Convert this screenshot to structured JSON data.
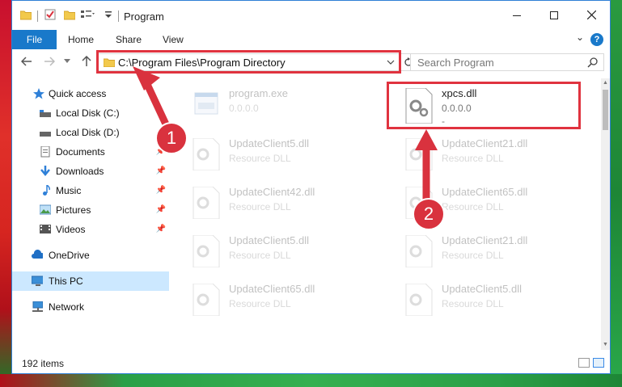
{
  "window": {
    "title": "Program"
  },
  "ribbon": {
    "file": "File",
    "tabs": [
      "Home",
      "Share",
      "View"
    ],
    "help": "?"
  },
  "navigation": {
    "address_path": "C:\\Program Files\\Program Directory",
    "search_placeholder": "Search Program"
  },
  "sidebar": {
    "items": [
      {
        "label": "Quick access",
        "icon": "star-icon"
      },
      {
        "label": "Local Disk (C:)",
        "icon": "drive-icon"
      },
      {
        "label": "Local Disk (D:)",
        "icon": "drive-icon"
      },
      {
        "label": "Documents",
        "icon": "documents-icon"
      },
      {
        "label": "Downloads",
        "icon": "download-icon"
      },
      {
        "label": "Music",
        "icon": "music-icon"
      },
      {
        "label": "Pictures",
        "icon": "pictures-icon"
      },
      {
        "label": "Videos",
        "icon": "videos-icon"
      },
      {
        "label": "OneDrive",
        "icon": "cloud-icon"
      },
      {
        "label": "This PC",
        "icon": "computer-icon"
      },
      {
        "label": "Network",
        "icon": "network-icon"
      }
    ]
  },
  "files": [
    {
      "name": "program.exe",
      "sub": "0.0.0.0"
    },
    {
      "name": "xpcs.dll",
      "sub": "0.0.0.0",
      "sub2": "-"
    },
    {
      "name": "UpdateClient5.dll",
      "sub": "Resource DLL"
    },
    {
      "name": "UpdateClient21.dll",
      "sub": "Resource DLL"
    },
    {
      "name": "UpdateClient42.dll",
      "sub": "Resource DLL"
    },
    {
      "name": "UpdateClient65.dll",
      "sub": "Resource DLL"
    },
    {
      "name": "UpdateClient5.dll",
      "sub": "Resource DLL"
    },
    {
      "name": "UpdateClient21.dll",
      "sub": "Resource DLL"
    },
    {
      "name": "UpdateClient65.dll",
      "sub": "Resource DLL"
    },
    {
      "name": "UpdateClient5.dll",
      "sub": "Resource DLL"
    }
  ],
  "status": {
    "items_count": "192 items"
  },
  "callouts": [
    "1",
    "2"
  ],
  "colors": {
    "accent": "#1979ca",
    "highlight": "#e0333f",
    "selection": "#cce8ff"
  }
}
